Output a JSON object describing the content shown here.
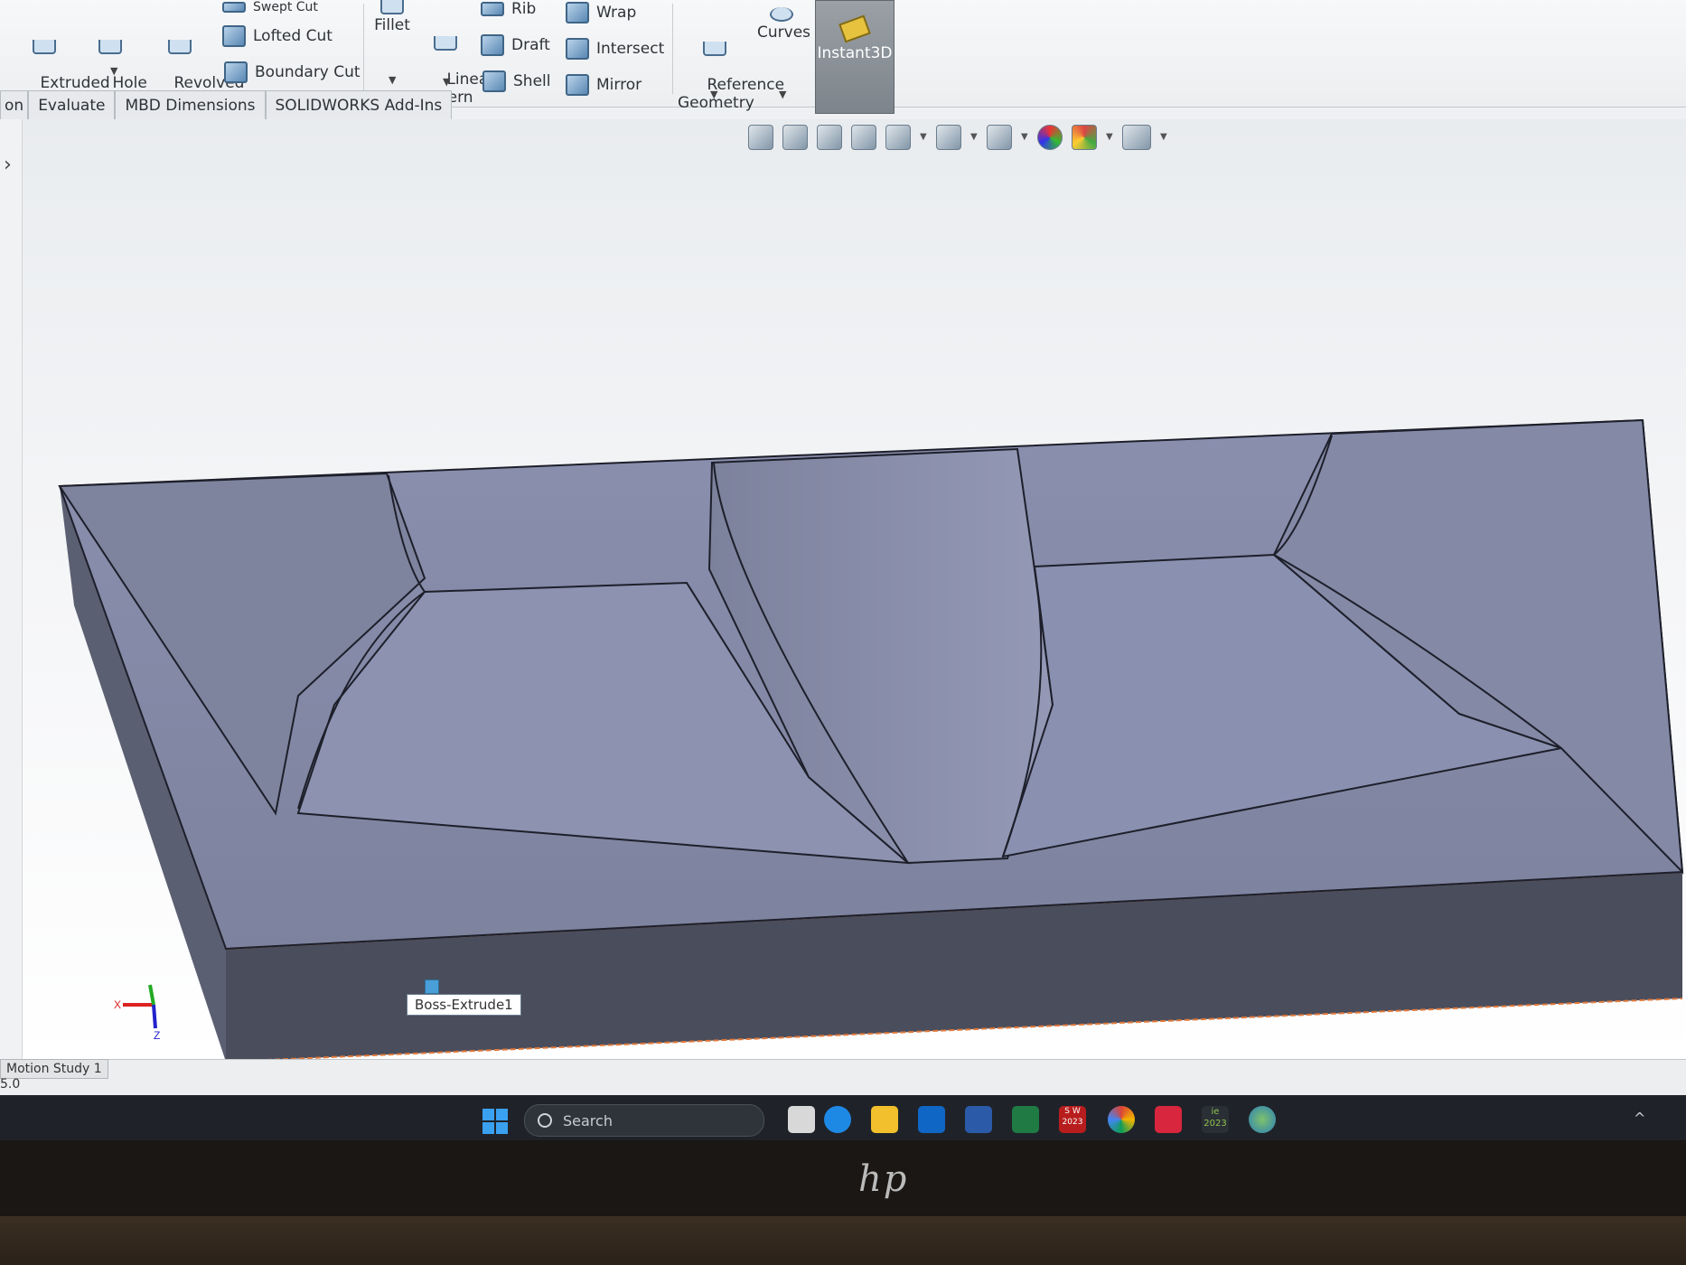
{
  "ribbon": {
    "extruded_cut": "Extruded\nCut",
    "hole_wizard": "Hole\nWizard",
    "revolved_cut": "Revolved\nCut",
    "swept_cut": "Swept Cut",
    "lofted_cut": "Lofted Cut",
    "boundary_cut": "Boundary Cut",
    "fillet": "Fillet",
    "linear_pattern": "Linear\nPattern",
    "rib": "Rib",
    "draft": "Draft",
    "shell": "Shell",
    "wrap": "Wrap",
    "intersect": "Intersect",
    "mirror": "Mirror",
    "reference_geometry": "Reference\nGeometry",
    "curves": "Curves",
    "instant3d": "Instant3D"
  },
  "tabs": [
    {
      "label": "on"
    },
    {
      "label": "Evaluate"
    },
    {
      "label": "MBD Dimensions"
    },
    {
      "label": "SOLIDWORKS Add-Ins"
    }
  ],
  "viewport": {
    "tooltip": "Boss-Extrude1",
    "triad_x": "X",
    "triad_z": "Z"
  },
  "status": {
    "motion_tab": "Motion Study 1",
    "version": "5.0"
  },
  "taskbar": {
    "search_placeholder": "Search",
    "sw_label": "S W\n2023",
    "ie_label": "ie\n2023"
  },
  "monitor": {
    "brand": "hp"
  },
  "colors": {
    "model_top": "#8a90ad",
    "model_front": "#4a4d5c",
    "edge_highlight": "#e07a3c",
    "instant3d_bg": "#8a9097"
  }
}
